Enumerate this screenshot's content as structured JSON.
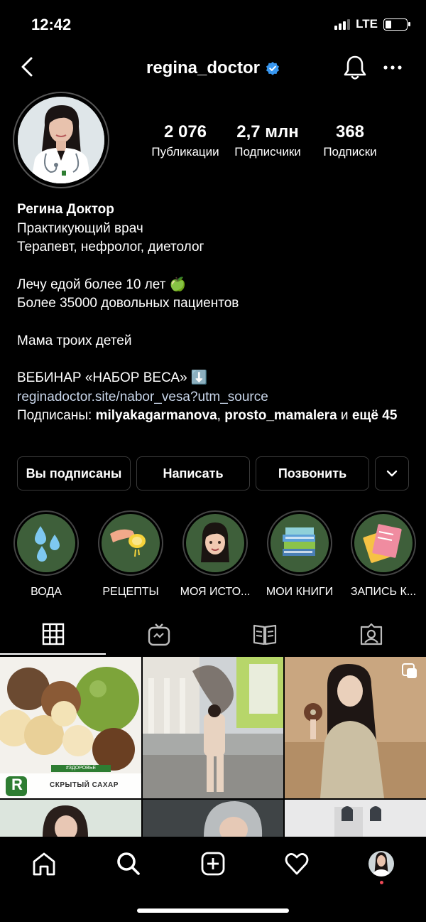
{
  "status": {
    "time": "12:42",
    "network": "LTE",
    "battery_level": 0.25
  },
  "header": {
    "username": "regina_doctor",
    "verified": true
  },
  "stats": [
    {
      "value": "2 076",
      "label": "Публикации"
    },
    {
      "value": "2,7 млн",
      "label": "Подписчики"
    },
    {
      "value": "368",
      "label": "Подписки"
    }
  ],
  "bio": {
    "name": "Регина Доктор",
    "lines": [
      "Практикующий врач",
      "Терапевт, нефролог, диетолог",
      "Лечу едой более 10 лет 🍏",
      "Более 35000 довольных пациентов",
      "Мама троих детей",
      "ВЕБИНАР «НАБОР ВЕСА» ⬇️"
    ],
    "link": "reginadoctor.site/nabor_vesa?utm_source",
    "followed_by_prefix": "Подписаны: ",
    "followed_by_user1": "milyakagarmanova",
    "followed_by_sep": ", ",
    "followed_by_user2": "prosto_mamalera",
    "followed_by_and": " и ",
    "followed_by_more": "ещё 45"
  },
  "actions": {
    "following": "Вы подписаны",
    "message": "Написать",
    "call": "Позвонить"
  },
  "highlights": [
    {
      "label": "ВОДА",
      "icon": "water-drops-icon"
    },
    {
      "label": "РЕЦЕПТЫ",
      "icon": "lemon-squeeze-icon"
    },
    {
      "label": "МОЯ ИСТО...",
      "icon": "memoji-icon"
    },
    {
      "label": "МОИ КНИГИ",
      "icon": "books-icon"
    },
    {
      "label": "ЗАПИСЬ К...",
      "icon": "notebook-icon"
    }
  ],
  "posts": [
    {
      "caption_tag": "#ЗДОРОВЬЕ",
      "caption": "СКРЫТЫЙ САХАР",
      "logo": "R"
    }
  ],
  "colors": {
    "background": "#000000",
    "highlight_bg": "#3e5f3a",
    "verified": "#3897f0",
    "notification_dot": "#ed4956"
  }
}
